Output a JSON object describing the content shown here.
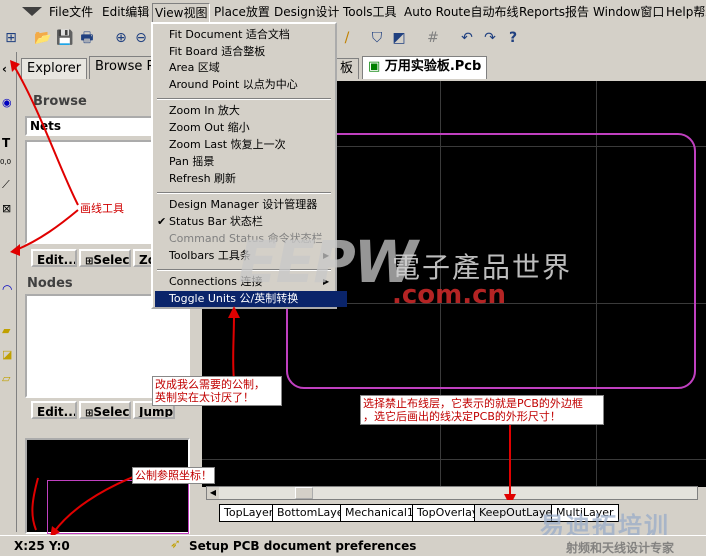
{
  "menubar": {
    "items": [
      "File文件",
      "Edit编辑",
      "View视图",
      "Place放置",
      "Design设计",
      "Tools工具",
      "Auto Route自动布线",
      "Reports报告",
      "Window窗口",
      "Help帮助"
    ]
  },
  "explorer": {
    "tab_explorer": "Explorer",
    "tab_browse": "Browse P",
    "section_title": "Browse",
    "dropdown_value": "Nets",
    "edit_label": "Edit...",
    "select_label": "Selec",
    "zoom_label": "Zo",
    "nodes_title": "Nodes",
    "edit2_label": "Edit...",
    "select2_label": "Selec",
    "jump_label": "Jump"
  },
  "doc_tabs": {
    "tab1": "板",
    "tab2": "万用实验板.Pcb"
  },
  "view_menu": {
    "items": [
      {
        "label": "Fit Document 适合文档",
        "type": "normal"
      },
      {
        "label": "Fit Board 适合整板",
        "type": "normal"
      },
      {
        "label": "Area 区域",
        "type": "normal"
      },
      {
        "label": "Around Point 以点为中心",
        "type": "normal"
      },
      {
        "type": "separator"
      },
      {
        "label": "Zoom In 放大",
        "type": "normal"
      },
      {
        "label": "Zoom Out  缩小",
        "type": "normal"
      },
      {
        "label": "Zoom Last 恢复上一次",
        "type": "normal"
      },
      {
        "label": "Pan 摇景",
        "type": "normal"
      },
      {
        "label": "Refresh  刷新",
        "type": "normal"
      },
      {
        "type": "separator"
      },
      {
        "label": "Design Manager 设计管理器",
        "type": "normal"
      },
      {
        "label": "Status Bar 状态栏",
        "type": "checked"
      },
      {
        "label": "Command Status 命令状态栏",
        "type": "disabled"
      },
      {
        "label": "Toolbars 工具条",
        "type": "submenu"
      },
      {
        "type": "separator"
      },
      {
        "label": "Connections 连接",
        "type": "submenu"
      },
      {
        "label": "Toggle Units 公/英制转换",
        "type": "highlighted"
      }
    ]
  },
  "watermark": {
    "logo": "EEPW",
    "chinese": "電子產品世界",
    "domain": ".com.cn",
    "bottom_logo": "易迪拓培训",
    "bottom_text": "射频和天线设计专家"
  },
  "annotations": {
    "draw_tool": "画线工具",
    "change_units": "改成我么需要的公制，\n英制实在太讨厌了！",
    "keepout": "选择禁止布线层，它表示的就是PCB的外边框\n，选它后画出的线决定PCB的外形尺寸！",
    "metric_coord": "公制参照坐标！"
  },
  "layers": [
    "TopLayer",
    "BottomLayer",
    "Mechanical1",
    "TopOverlay",
    "KeepOutLayer",
    "MultiLayer"
  ],
  "status": {
    "coords": "X:25 Y:0",
    "message": "Setup PCB document preferences"
  },
  "colors": {
    "menu_highlight": "#0a246a",
    "board_outline": "#c040c0",
    "canvas": "#000000",
    "annotation_red": "#d00000"
  }
}
